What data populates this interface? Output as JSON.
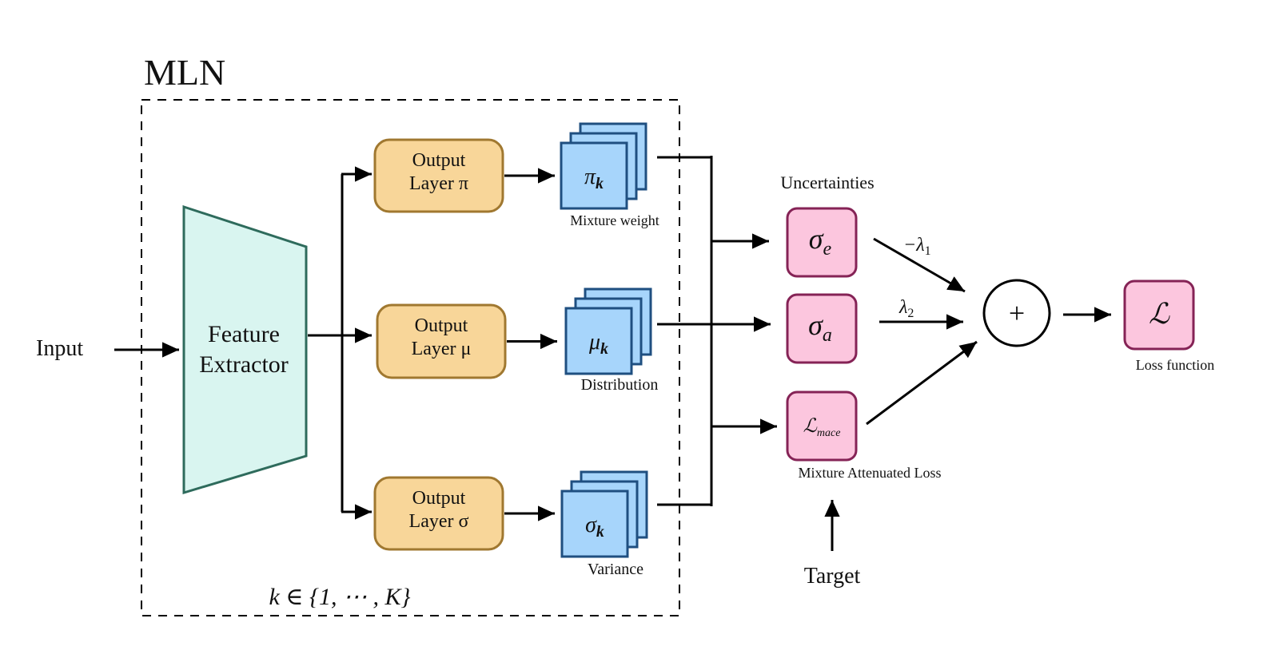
{
  "diagram": {
    "title": "MLN",
    "container_caption": "k ∈ {1, ⋯ , K}",
    "input_label": "Input",
    "feature_extractor": {
      "line1": "Feature",
      "line2": "Extractor"
    },
    "output_layers": [
      {
        "line1": "Output",
        "line2": "Layer π"
      },
      {
        "line1": "Output",
        "line2": "Layer μ"
      },
      {
        "line1": "Output",
        "line2": "Layer σ"
      }
    ],
    "stacks": [
      {
        "symbol": "π",
        "sub": "k",
        "caption": "Mixture weight"
      },
      {
        "symbol": "μ",
        "sub": "k",
        "caption": "Distribution"
      },
      {
        "symbol": "σ",
        "sub": "k",
        "caption": "Variance"
      }
    ],
    "uncertainties_heading": "Uncertainties",
    "uncertainty_boxes": [
      {
        "symbol": "σ",
        "sub": "e"
      },
      {
        "symbol": "σ",
        "sub": "a"
      },
      {
        "symbol": "ℒ",
        "sub": "mace",
        "caption": "Mixture Attenuated Loss"
      }
    ],
    "weights": [
      {
        "text": "−λ",
        "sub": "1"
      },
      {
        "text": "λ",
        "sub": "2"
      }
    ],
    "target_label": "Target",
    "sum_symbol": "+",
    "loss_box": {
      "symbol": "ℒ",
      "caption": "Loss function"
    }
  },
  "colors": {
    "feature_fill": "#d9f5f0",
    "feature_stroke": "#2e6b5c",
    "output_fill": "#f8d699",
    "output_stroke": "#a07830",
    "stack_fill": "#a7d5fb",
    "stack_stroke": "#1f4f80",
    "pink_fill": "#fcc6de",
    "pink_stroke": "#852356"
  }
}
